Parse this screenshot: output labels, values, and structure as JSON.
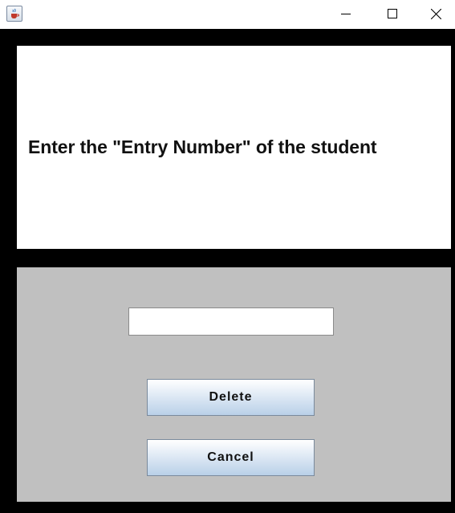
{
  "window": {
    "icon": "java-cup-icon",
    "controls": [
      "minimize-icon",
      "maximize-icon",
      "close-icon"
    ]
  },
  "prompt": {
    "text": "Enter the \"Entry Number\" of the student"
  },
  "form": {
    "entry_value": "",
    "delete_label": "Delete",
    "cancel_label": "Cancel"
  },
  "colors": {
    "background": "#000000",
    "top_panel": "#ffffff",
    "bottom_panel": "#c0c0c0",
    "button_gradient_top": "#ffffff",
    "button_gradient_bottom": "#b9d0e8"
  }
}
